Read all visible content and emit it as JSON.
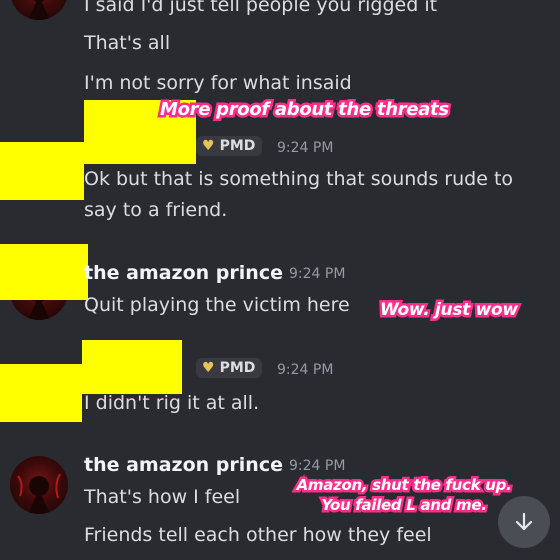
{
  "messages": {
    "line_top": "I said I'd just tell people you rigged it",
    "line_thats_all": "That's all",
    "line_not_sorry": "I'm not sorry for what insaid",
    "pmd_1": {
      "badge": "PMD",
      "time": "9:24 PM",
      "line1": "Ok but that is something that sounds rude to",
      "line2": "say to a friend."
    },
    "prince_1": {
      "username": "the amazon prince",
      "time": "9:24 PM",
      "line1": "Quit playing the victim here"
    },
    "pmd_2": {
      "badge": "PMD",
      "time": "9:24 PM",
      "line1": "I didn't rig it at all."
    },
    "prince_2": {
      "username": "the amazon prince",
      "time": "9:24 PM",
      "line1": "That's how I feel",
      "line2": "Friends tell each other how they feel"
    }
  },
  "overlays": {
    "threats": "More proof about the threats",
    "wow": "Wow. just wow",
    "shut_line1": "Amazon, shut the fuck up.",
    "shut_line2": "You failed L and me."
  },
  "icons": {
    "badge_heart": "heart-icon",
    "scroll": "arrow-down-icon"
  },
  "colors": {
    "background": "#2a2b31",
    "redaction": "#ffff00",
    "sticker_outline": "#ff2d8a"
  }
}
